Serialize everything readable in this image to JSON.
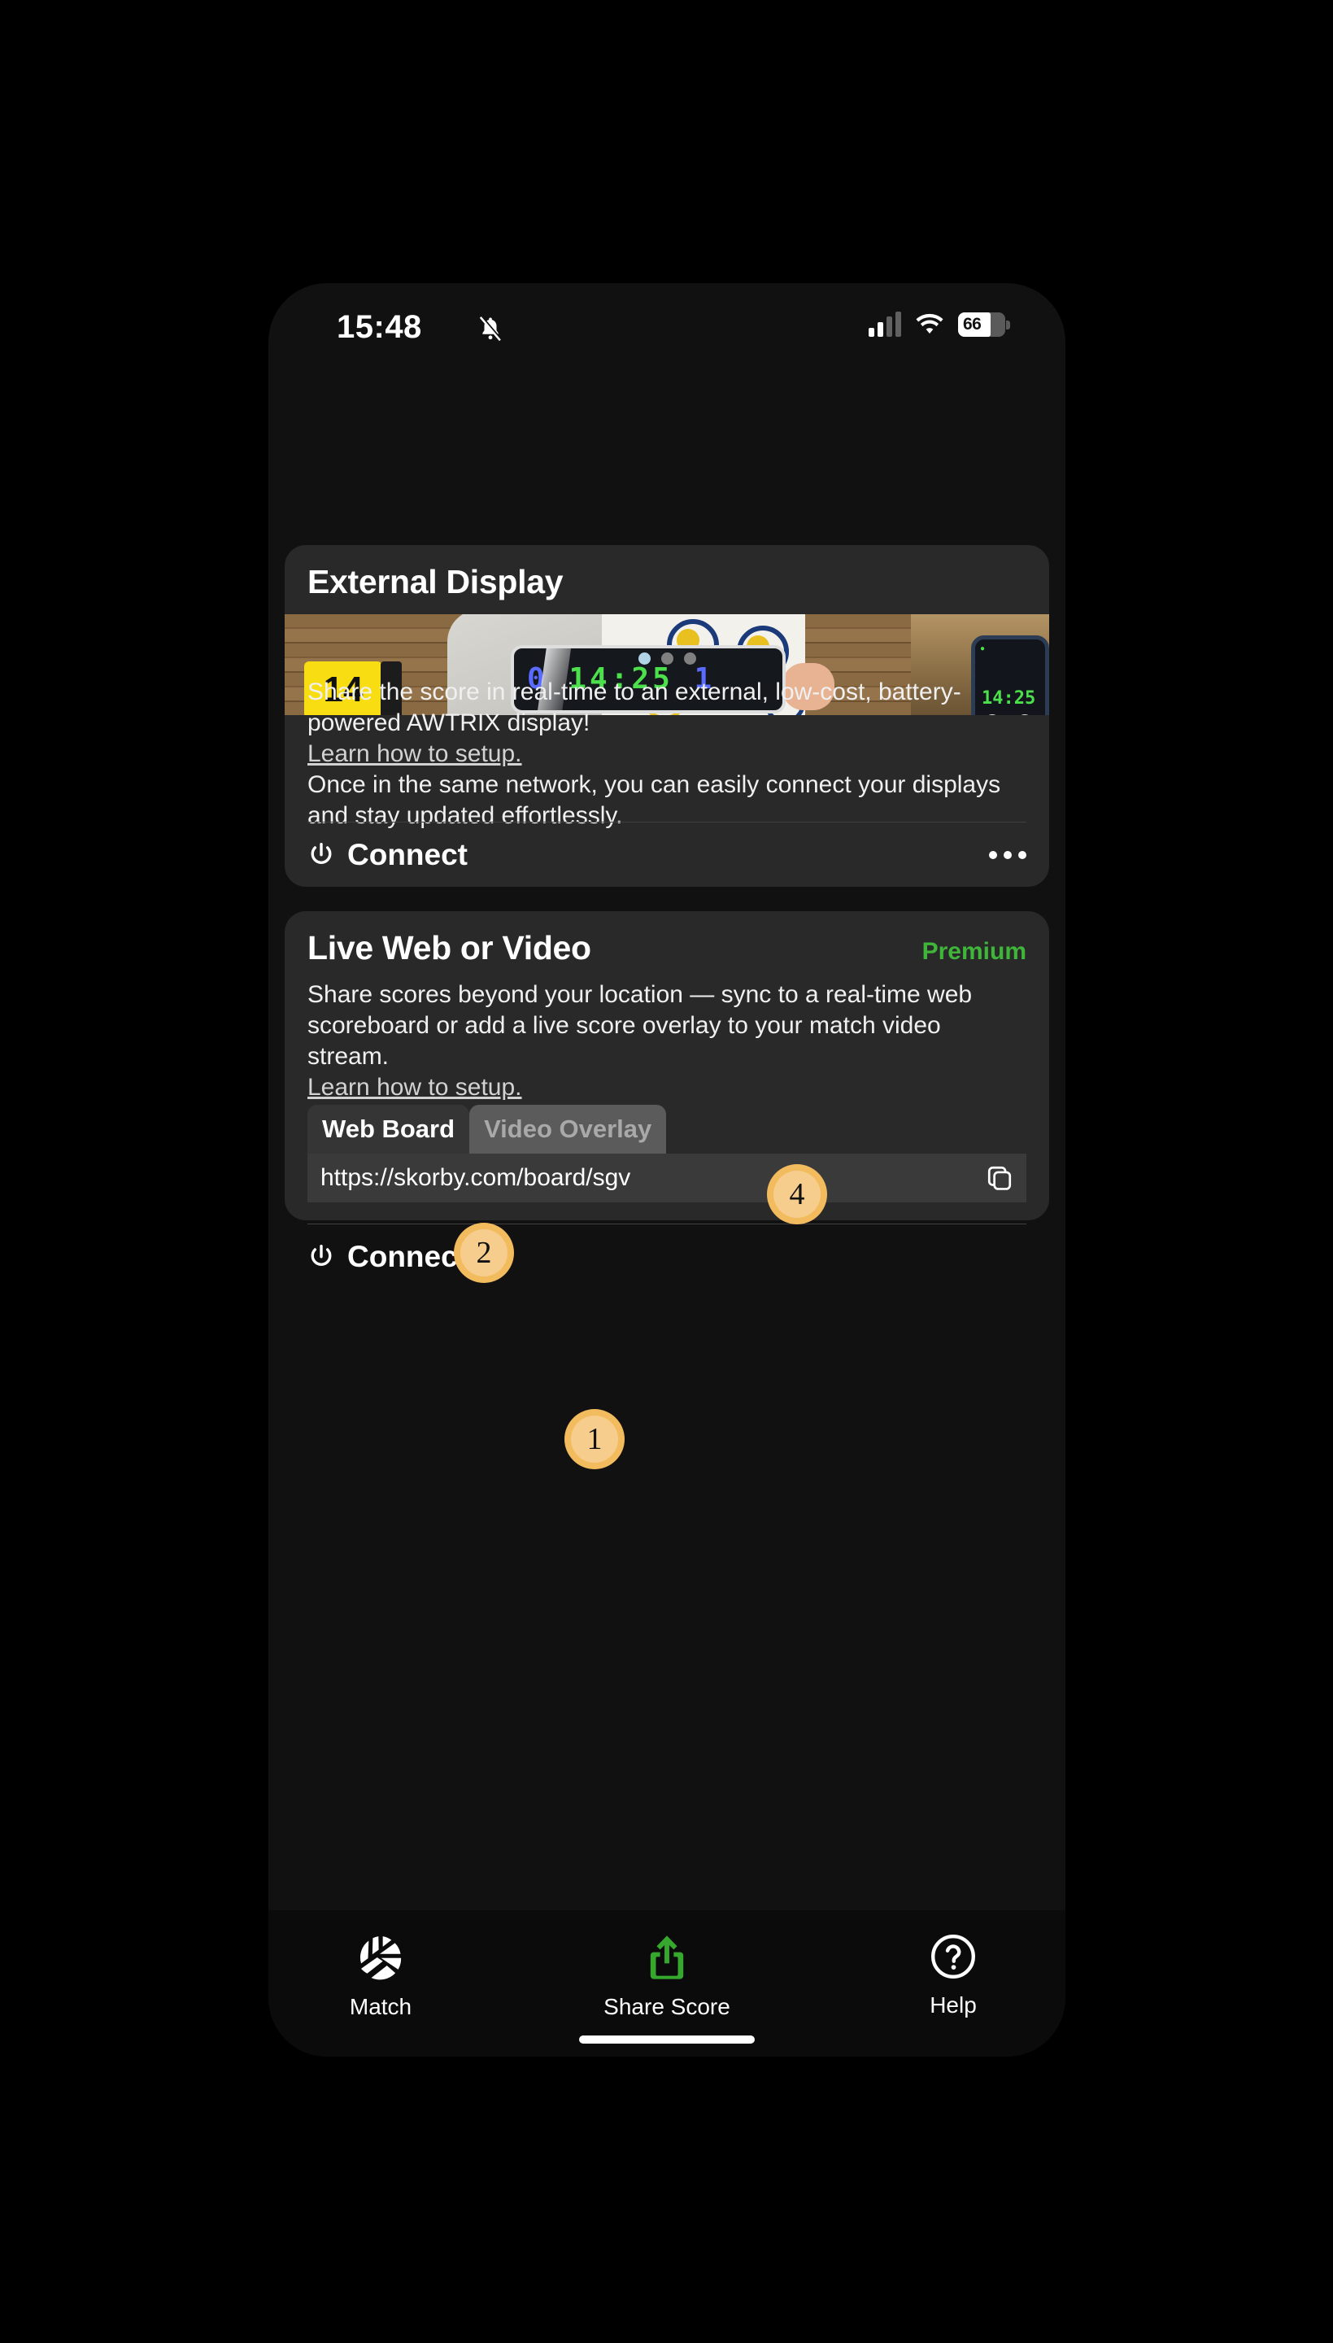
{
  "statusbar": {
    "time": "15:48",
    "silent_icon": "bell-slash-icon",
    "signal_icon": "cellular-signal-icon",
    "wifi_icon": "wifi-icon",
    "battery_level": "66"
  },
  "cards": {
    "external_display": {
      "title": "External Display",
      "hero": {
        "led_left_digit": "0",
        "led_time": "14:25",
        "led_right_digit": "1",
        "scoreboard_number": "14",
        "phone_time": "14:25"
      },
      "carousel": {
        "total": 3,
        "active_index": 0
      },
      "description": "Share the score in real-time to an external, low-cost, battery-powered AWTRIX display!",
      "link": "Learn how to setup.",
      "description2": "Once in the same network, you can easily connect your displays and stay updated effortlessly.",
      "connect_label": "Connect",
      "power_icon": "power-icon",
      "more_icon": "ellipsis-icon"
    },
    "live_web_or_video": {
      "title": "Live Web or Video",
      "premium_label": "Premium",
      "description": "Share scores beyond your location — sync to a real-time web scoreboard or add a live score overlay to your match video stream.",
      "link": "Learn how to setup.",
      "tabs": [
        {
          "label": "Web Board",
          "selected": true
        },
        {
          "label": "Video Overlay",
          "selected": false
        }
      ],
      "url": "https://skorby.com/board/sgv",
      "copy_icon": "copy-icon",
      "connect_label": "Connect",
      "power_icon": "power-icon"
    }
  },
  "tabbar": {
    "items": [
      {
        "label": "Match",
        "icon": "volleyball-icon",
        "active": false
      },
      {
        "label": "Share Score",
        "icon": "share-icon",
        "active": true
      },
      {
        "label": "Help",
        "icon": "question-circle-icon",
        "active": false
      }
    ]
  },
  "annotations": [
    {
      "number": "1"
    },
    {
      "number": "2"
    },
    {
      "number": "4"
    }
  ],
  "colors": {
    "page_background": "#000000",
    "phone_background": "#111111",
    "card_background": "#292929",
    "accent_green": "#3fb53a",
    "badge_outer": "#f2bc5e",
    "badge_inner": "#f7cd8d",
    "active_dot": "#b1d5e6",
    "inactive_dot": "#808080"
  }
}
